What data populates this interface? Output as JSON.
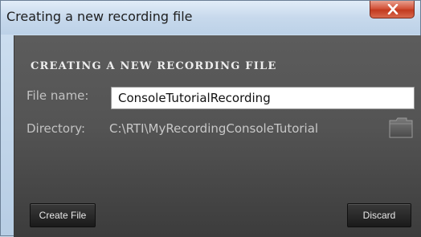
{
  "window": {
    "title": "Creating a new recording file"
  },
  "dialog": {
    "heading": "Creating a new recording file",
    "file_name_label": "File name:",
    "file_name_value": "ConsoleTutorialRecording",
    "directory_label": "Directory:",
    "directory_value": "C:\\RTI\\MyRecordingConsoleTutorial",
    "folder_icon": "folder-icon"
  },
  "buttons": {
    "create_file": "Create File",
    "discard": "Discard"
  },
  "colors": {
    "close_button": "#c94a2f",
    "content_background": "#555555",
    "title_bar": "#c7d9ec"
  }
}
